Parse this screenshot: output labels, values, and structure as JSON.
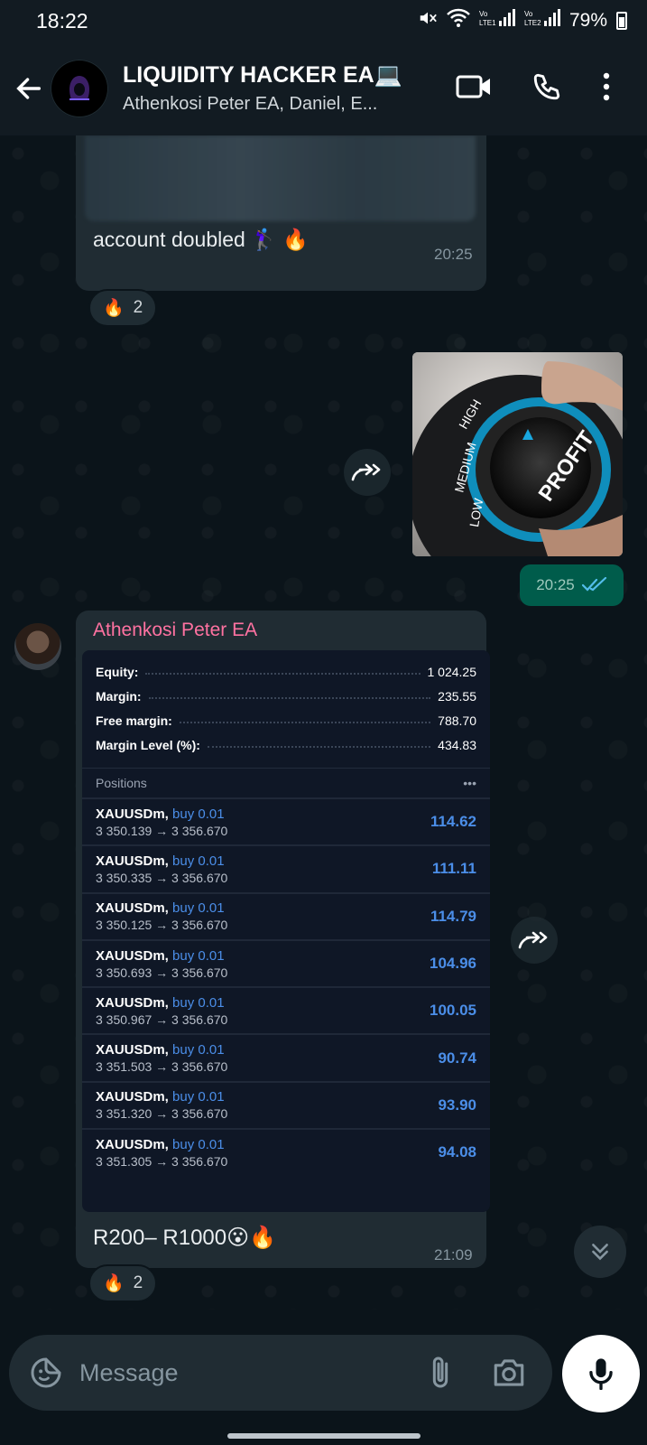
{
  "status_bar": {
    "time": "18:22",
    "sim1": "Vo LTE1",
    "sim2": "Vo LTE2",
    "battery": "79%"
  },
  "header": {
    "title": "LIQUIDITY HACKER EA💻",
    "subtitle": "Athenkosi Peter EA, Daniel, E..."
  },
  "messages": {
    "msg1": {
      "text": "account doubled 🏌🏾‍♀️ 🔥",
      "time": "20:25",
      "reaction_emoji": "🔥",
      "reaction_count": "2"
    },
    "msg2": {
      "time": "20:25",
      "image_labels": [
        "LOW",
        "MEDIUM",
        "HIGH",
        "PROFIT"
      ]
    },
    "msg3": {
      "sender": "Athenkosi Peter EA",
      "text": "R200– R1000😮🔥",
      "time": "21:09",
      "reaction_emoji": "🔥",
      "reaction_count": "2",
      "account": [
        {
          "label": "Equity:",
          "value": "1 024.25"
        },
        {
          "label": "Margin:",
          "value": "235.55"
        },
        {
          "label": "Free margin:",
          "value": "788.70"
        },
        {
          "label": "Margin Level (%):",
          "value": "434.83"
        }
      ],
      "positions_label": "Positions",
      "positions_menu": "•••",
      "positions": [
        {
          "symbol": "XAUUSDm,",
          "side": "buy 0.01",
          "prices": "3 350.139 → 3 356.670",
          "profit": "114.62"
        },
        {
          "symbol": "XAUUSDm,",
          "side": "buy 0.01",
          "prices": "3 350.335 → 3 356.670",
          "profit": "111.11"
        },
        {
          "symbol": "XAUUSDm,",
          "side": "buy 0.01",
          "prices": "3 350.125 → 3 356.670",
          "profit": "114.79"
        },
        {
          "symbol": "XAUUSDm,",
          "side": "buy 0.01",
          "prices": "3 350.693 → 3 356.670",
          "profit": "104.96"
        },
        {
          "symbol": "XAUUSDm,",
          "side": "buy 0.01",
          "prices": "3 350.967 → 3 356.670",
          "profit": "100.05"
        },
        {
          "symbol": "XAUUSDm,",
          "side": "buy 0.01",
          "prices": "3 351.503 → 3 356.670",
          "profit": "90.74"
        },
        {
          "symbol": "XAUUSDm,",
          "side": "buy 0.01",
          "prices": "3 351.320 → 3 356.670",
          "profit": "93.90"
        },
        {
          "symbol": "XAUUSDm,",
          "side": "buy 0.01",
          "prices": "3 351.305 → 3 356.670",
          "profit": "94.08"
        }
      ]
    }
  },
  "input": {
    "placeholder": "Message"
  },
  "colors": {
    "accent": "#00a884",
    "sender_name": "#ff72a1",
    "outgoing_bubble": "#005c4b",
    "incoming_bubble": "#202c33",
    "profit_value": "#4b8ee8"
  }
}
